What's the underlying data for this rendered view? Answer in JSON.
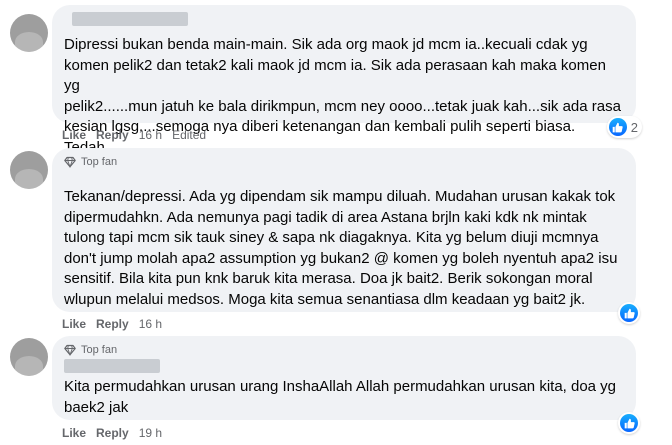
{
  "comments": [
    {
      "badge": "",
      "text": "Dipressi bukan benda main-main. Sik ada org maok jd mcm ia..kecuali cdak yg\nkomen pelik2 dan tetak2 kali maok jd mcm ia. Sik ada perasaan kah maka komen yg\npelik2......mun jatuh ke bala dirikmpun, mcm ney oooo...tetak juak kah...sik ada rasa\nkesian lgsg....semoga nya diberi ketenangan dan kembali pulih seperti biasa. Tedah...",
      "actions": {
        "like": "Like",
        "reply": "Reply",
        "time": "16 h",
        "edited": "Edited"
      },
      "reaction_count": "2",
      "reaction_icon": "like-icon"
    },
    {
      "badge": "Top fan",
      "text": "Tekanan/depressi. Ada yg dipendam sik mampu diluah. Mudahan urusan kakak tok\ndipermudahkn. Ada nemunya pagi tadik di area Astana brjln kaki kdk nk mintak\ntulong tapi mcm sik tauk siney & sapa nk diagaknya. Kita yg belum diuji mcmnya\ndon't jump molah apa2 assumption yg bukan2 @ komen yg boleh nyentuh apa2 isu\nsensitif. Bila kita pun knk baruk kita merasa. Doa jk bait2. Berik sokongan moral\nwlupun melalui medsos. Moga kita semua senantiasa dlm keadaan yg bait2 jk.",
      "actions": {
        "like": "Like",
        "reply": "Reply",
        "time": "16 h"
      },
      "reaction_count": "",
      "reaction_icon": "like-icon"
    },
    {
      "badge": "Top fan",
      "text": "Kita permudahkan urusan urang InshaAllah Allah permudahkan urusan kita, doa yg\nbaek2 jak",
      "actions": {
        "like": "Like",
        "reply": "Reply",
        "time": "19 h"
      },
      "reaction_count": "",
      "reaction_icon": "like-icon"
    }
  ],
  "colors": {
    "bubble": "#f0f2f5",
    "meta_text": "#65676b",
    "like_blue": "#0866ff"
  }
}
